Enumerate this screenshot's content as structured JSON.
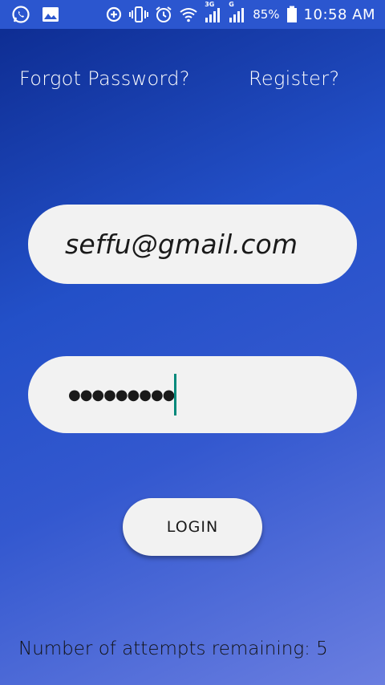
{
  "statusbar": {
    "icons_left": [
      "whatsapp-icon",
      "gallery-icon"
    ],
    "icons_right": [
      "data-saver-icon",
      "vibrate-icon",
      "alarm-icon",
      "wifi-icon",
      "signal-3g-icon",
      "signal-g-icon"
    ],
    "net_3g": "3G",
    "net_g": "G",
    "battery_pct": "85%",
    "time": "10:58 AM"
  },
  "links": {
    "forgot": "Forgot Password?",
    "register": "Register?"
  },
  "form": {
    "email_value": "seffu@gmail.com",
    "password_mask": "●●●●●●●●●",
    "login_label": "LOGIN"
  },
  "footer": {
    "attempts_text": "Number of attempts remaining: 5"
  },
  "colors": {
    "status_bar": "#2b56cf",
    "field_bg": "#f2f2f2",
    "caret": "#00897b"
  }
}
